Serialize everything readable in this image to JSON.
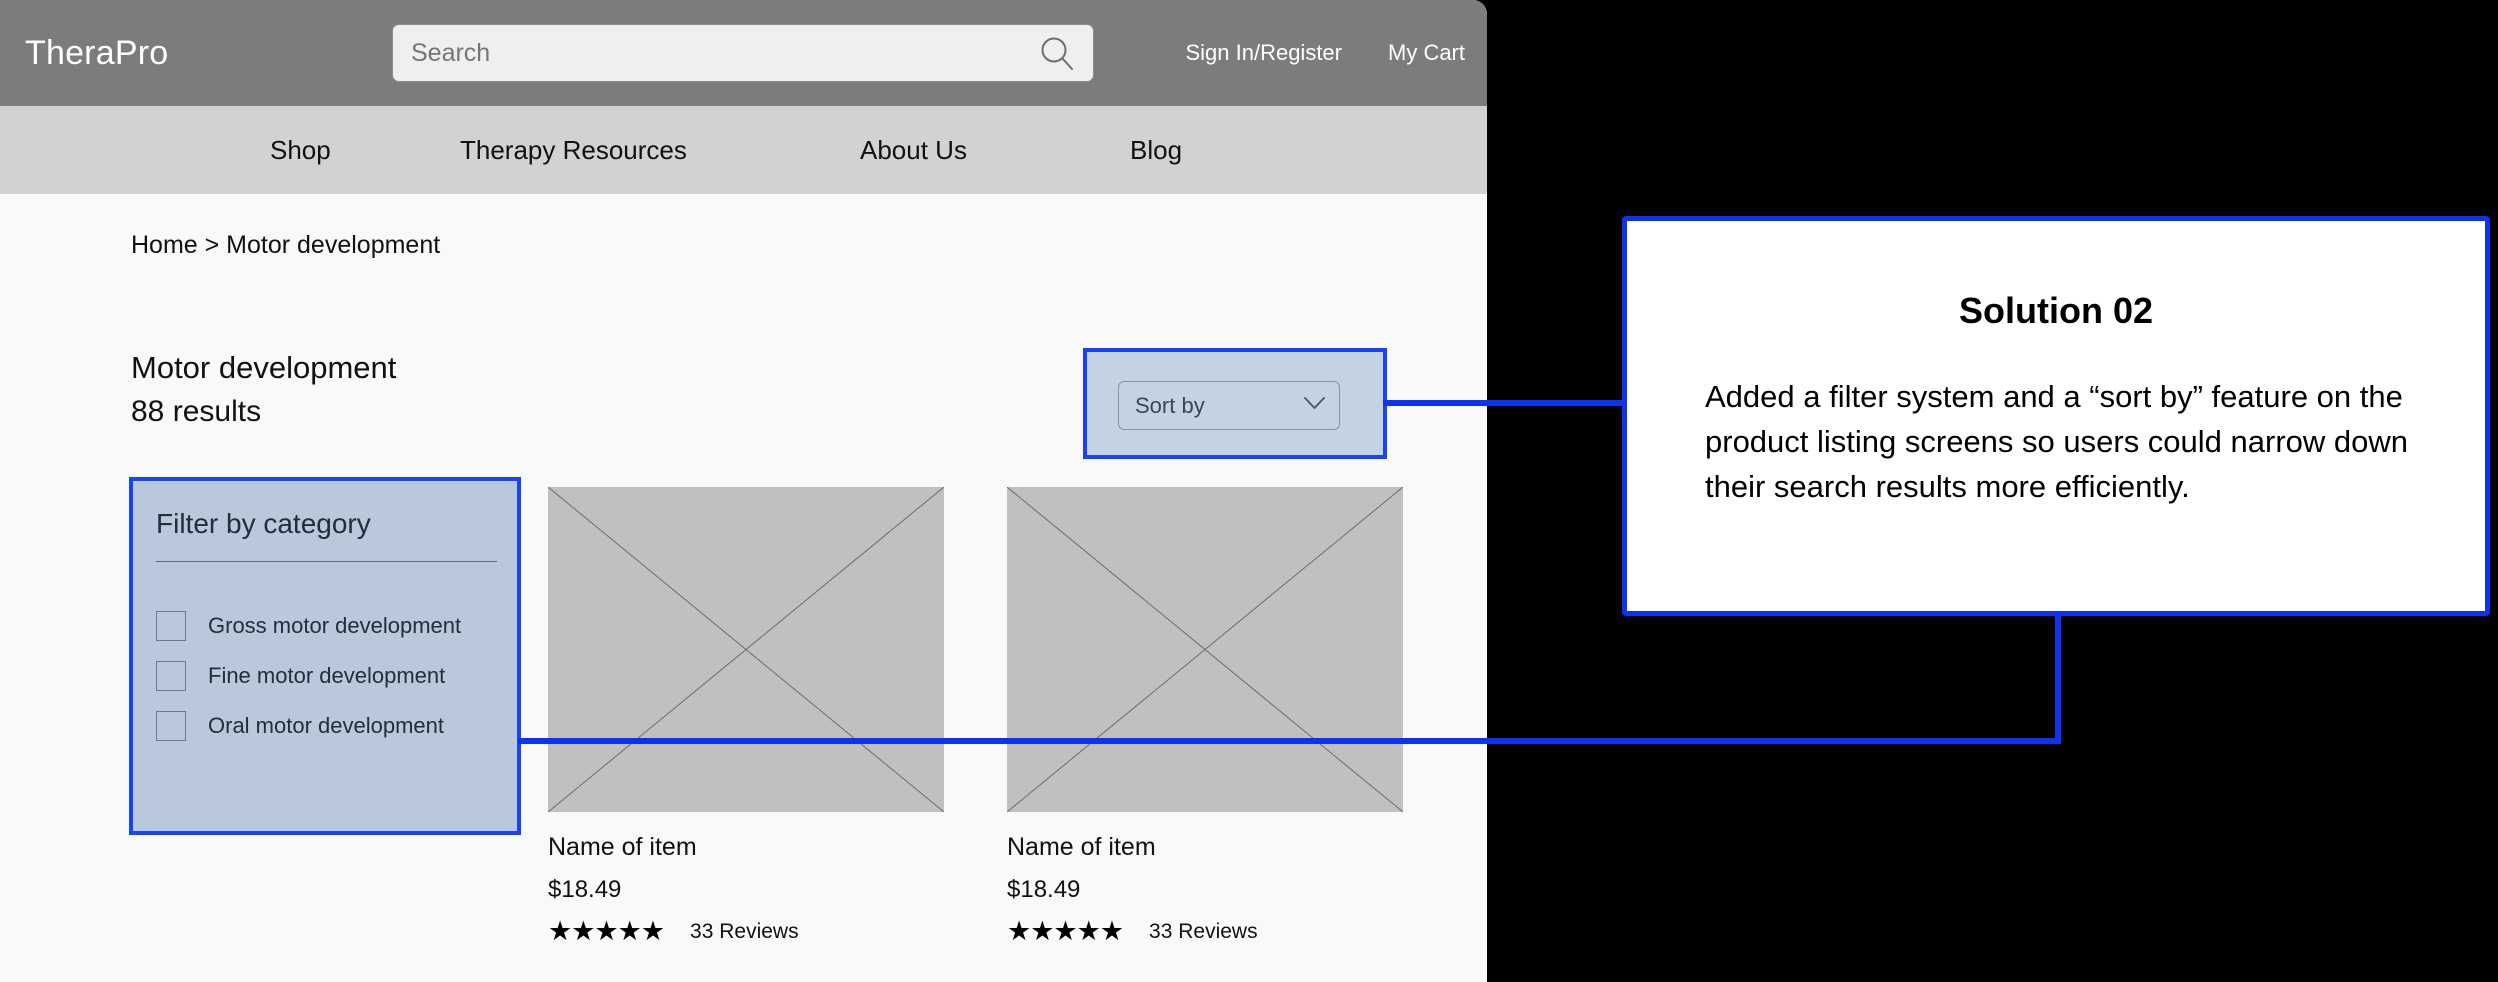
{
  "colors": {
    "accent_blue": "#0d33f2",
    "highlight_border": "#1a43f5",
    "filter_panel_fill": "#b9c9db",
    "sort_highlight_fill": "#c3d3e4",
    "header_gray": "#7c7c7c",
    "nav_gray": "#d2d2d2",
    "page_bg": "#f9f9f9",
    "thumb_gray": "#c0c0c0",
    "canvas_black": "#000000"
  },
  "header": {
    "brand": "TheraPro",
    "search": {
      "value": "",
      "placeholder": "Search",
      "icon": "search-icon"
    },
    "links": [
      {
        "label": "Sign In/Register"
      },
      {
        "label": "My Cart"
      }
    ]
  },
  "nav": {
    "items": [
      {
        "label": "Shop"
      },
      {
        "label": "Therapy Resources"
      },
      {
        "label": "About Us"
      },
      {
        "label": "Blog"
      }
    ]
  },
  "page": {
    "breadcrumb": "Home > Motor development",
    "title": "Motor development",
    "result_count": "88 results"
  },
  "sort": {
    "label": "Sort by",
    "chevron_icon": "chevron-down-icon"
  },
  "filter": {
    "heading": "Filter by category",
    "options": [
      {
        "label": "Gross motor development",
        "checked": false
      },
      {
        "label": "Fine motor development",
        "checked": false
      },
      {
        "label": "Oral motor development",
        "checked": false
      }
    ]
  },
  "products": [
    {
      "name": "Name of item",
      "price": "$18.49",
      "stars": "★★★★★",
      "reviews": "33 Reviews"
    },
    {
      "name": "Name of item",
      "price": "$18.49",
      "stars": "★★★★★",
      "reviews": "33 Reviews"
    }
  ],
  "callout": {
    "title": "Solution 02",
    "body": "Added a filter system and a “sort by” feature on the product listing screens so users could narrow down their search results more efficiently."
  }
}
